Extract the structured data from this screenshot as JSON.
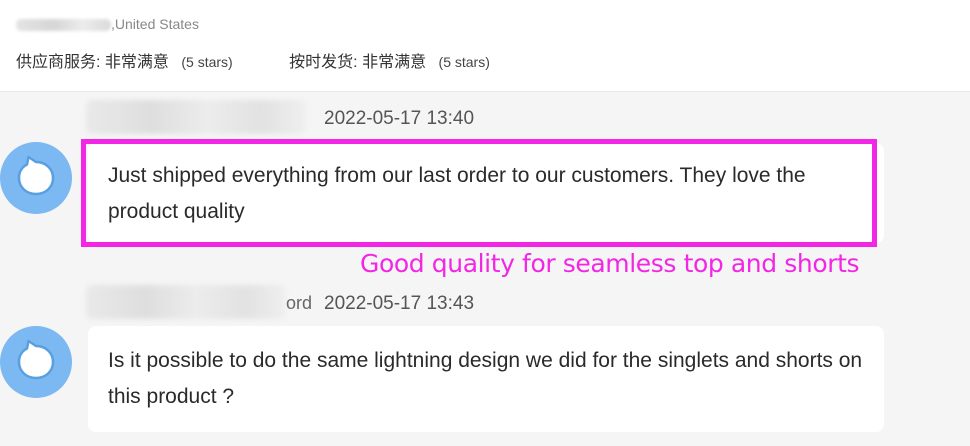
{
  "header": {
    "location_suffix": ",United States",
    "ratings": [
      {
        "label": "供应商服务:",
        "value": "非常满意",
        "stars": "(5 stars)"
      },
      {
        "label": "按时发货:",
        "value": "非常满意",
        "stars": "(5 stars)"
      }
    ]
  },
  "messages": [
    {
      "timestamp": "2022-05-17 13:40",
      "text": "Just shipped everything from our last order to our customers. They love the product quality"
    },
    {
      "name_suffix": "ord",
      "timestamp": "2022-05-17 13:43",
      "text": "Is it possible to do the same lightning design we did for the singlets and shorts on this product ?"
    }
  ],
  "annotation": {
    "text": "Good quality for seamless top and shorts",
    "color": "#f226e4"
  },
  "colors": {
    "avatar": "#7cb8f1",
    "background": "#f5f5f5"
  },
  "icons": [
    "chat-bubble-avatar-icon"
  ]
}
